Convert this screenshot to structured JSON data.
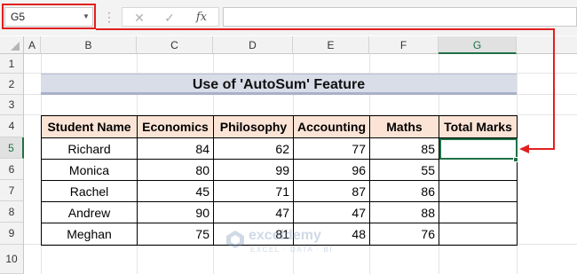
{
  "formula_bar": {
    "name_box": "G5",
    "cancel_glyph": "✕",
    "enter_glyph": "✓",
    "fx_glyph": "fx",
    "formula": ""
  },
  "columns": [
    "A",
    "B",
    "C",
    "D",
    "E",
    "F",
    "G"
  ],
  "rows": [
    "1",
    "2",
    "3",
    "4",
    "5",
    "6",
    "7",
    "8",
    "9",
    "10"
  ],
  "sheet": {
    "title": "Use of 'AutoSum' Feature",
    "headers": [
      "Student Name",
      "Economics",
      "Philosophy",
      "Accounting",
      "Maths",
      "Total Marks"
    ],
    "records": [
      [
        "Richard",
        "84",
        "62",
        "77",
        "85",
        ""
      ],
      [
        "Monica",
        "80",
        "99",
        "96",
        "55",
        ""
      ],
      [
        "Rachel",
        "45",
        "71",
        "87",
        "86",
        ""
      ],
      [
        "Andrew",
        "90",
        "47",
        "47",
        "88",
        ""
      ],
      [
        "Meghan",
        "75",
        "81",
        "48",
        "76",
        ""
      ]
    ],
    "selected_cell": "G5"
  },
  "watermark": {
    "name": "exceldemy",
    "tagline": "EXCEL · DATA · BI"
  },
  "colors": {
    "header_fill": "#fbe4d5",
    "selection": "#1e7145",
    "highlight": "#e0201f",
    "title_fill": "#d9dde8"
  }
}
